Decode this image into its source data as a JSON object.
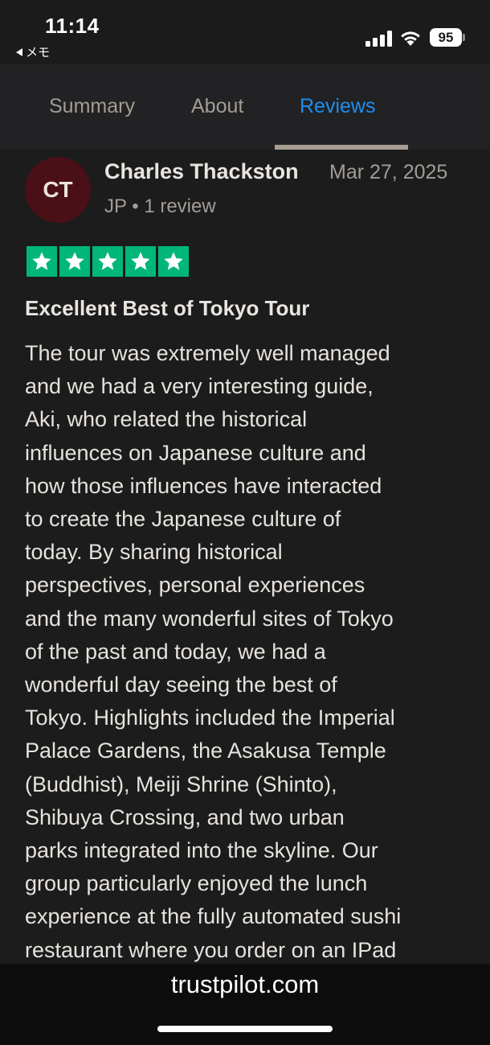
{
  "status_bar": {
    "time": "11:14",
    "back_app": "メモ",
    "battery": "95"
  },
  "tabs": [
    {
      "label": "Summary"
    },
    {
      "label": "About"
    },
    {
      "label": "Reviews"
    }
  ],
  "active_tab": "Reviews",
  "colors": {
    "accent": "#1e8ef0",
    "star_green": "#00b67a",
    "avatar_bg": "#4a0f17"
  },
  "review": {
    "avatar_initials": "CT",
    "reviewer_name": "Charles Thackston",
    "date": "Mar 27, 2025",
    "reviewer_meta": "JP • 1 review",
    "rating": 5,
    "title": "Excellent Best of Tokyo Tour",
    "body": "The tour was extremely well managed\nand we had a very interesting guide,\nAki, who related the historical\ninfluences on Japanese culture and\nhow those influences have interacted\nto create the Japanese culture of\ntoday. By sharing historical\nperspectives, personal experiences\nand the many wonderful sites of Tokyo\nof the past and today, we had a\nwonderful day seeing the best of\nTokyo. Highlights included the Imperial\nPalace Gardens, the Asakusa Temple\n(Buddhist), Meiji Shrine (Shinto),\nShibuya Crossing, and two urban\nparks integrated into the skyline. Our\ngroup particularly enjoyed the lunch\nexperience at the fully automated sushi\nrestaurant where you order on an IPad"
  },
  "browser": {
    "url": "trustpilot.com"
  }
}
